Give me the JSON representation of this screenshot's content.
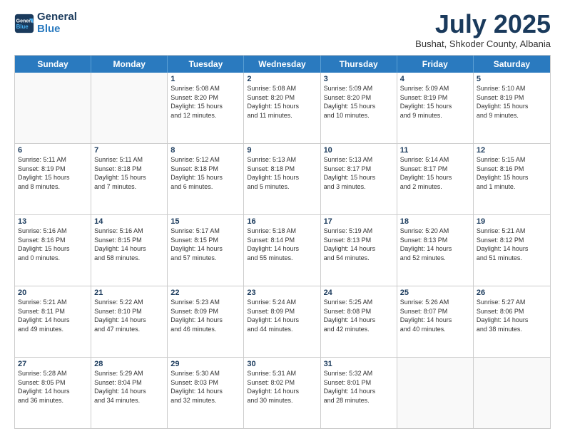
{
  "logo": {
    "general": "General",
    "blue": "Blue"
  },
  "header": {
    "month": "July 2025",
    "location": "Bushat, Shkoder County, Albania"
  },
  "weekdays": [
    "Sunday",
    "Monday",
    "Tuesday",
    "Wednesday",
    "Thursday",
    "Friday",
    "Saturday"
  ],
  "rows": [
    [
      {
        "day": "",
        "info": ""
      },
      {
        "day": "",
        "info": ""
      },
      {
        "day": "1",
        "info": "Sunrise: 5:08 AM\nSunset: 8:20 PM\nDaylight: 15 hours\nand 12 minutes."
      },
      {
        "day": "2",
        "info": "Sunrise: 5:08 AM\nSunset: 8:20 PM\nDaylight: 15 hours\nand 11 minutes."
      },
      {
        "day": "3",
        "info": "Sunrise: 5:09 AM\nSunset: 8:20 PM\nDaylight: 15 hours\nand 10 minutes."
      },
      {
        "day": "4",
        "info": "Sunrise: 5:09 AM\nSunset: 8:19 PM\nDaylight: 15 hours\nand 9 minutes."
      },
      {
        "day": "5",
        "info": "Sunrise: 5:10 AM\nSunset: 8:19 PM\nDaylight: 15 hours\nand 9 minutes."
      }
    ],
    [
      {
        "day": "6",
        "info": "Sunrise: 5:11 AM\nSunset: 8:19 PM\nDaylight: 15 hours\nand 8 minutes."
      },
      {
        "day": "7",
        "info": "Sunrise: 5:11 AM\nSunset: 8:18 PM\nDaylight: 15 hours\nand 7 minutes."
      },
      {
        "day": "8",
        "info": "Sunrise: 5:12 AM\nSunset: 8:18 PM\nDaylight: 15 hours\nand 6 minutes."
      },
      {
        "day": "9",
        "info": "Sunrise: 5:13 AM\nSunset: 8:18 PM\nDaylight: 15 hours\nand 5 minutes."
      },
      {
        "day": "10",
        "info": "Sunrise: 5:13 AM\nSunset: 8:17 PM\nDaylight: 15 hours\nand 3 minutes."
      },
      {
        "day": "11",
        "info": "Sunrise: 5:14 AM\nSunset: 8:17 PM\nDaylight: 15 hours\nand 2 minutes."
      },
      {
        "day": "12",
        "info": "Sunrise: 5:15 AM\nSunset: 8:16 PM\nDaylight: 15 hours\nand 1 minute."
      }
    ],
    [
      {
        "day": "13",
        "info": "Sunrise: 5:16 AM\nSunset: 8:16 PM\nDaylight: 15 hours\nand 0 minutes."
      },
      {
        "day": "14",
        "info": "Sunrise: 5:16 AM\nSunset: 8:15 PM\nDaylight: 14 hours\nand 58 minutes."
      },
      {
        "day": "15",
        "info": "Sunrise: 5:17 AM\nSunset: 8:15 PM\nDaylight: 14 hours\nand 57 minutes."
      },
      {
        "day": "16",
        "info": "Sunrise: 5:18 AM\nSunset: 8:14 PM\nDaylight: 14 hours\nand 55 minutes."
      },
      {
        "day": "17",
        "info": "Sunrise: 5:19 AM\nSunset: 8:13 PM\nDaylight: 14 hours\nand 54 minutes."
      },
      {
        "day": "18",
        "info": "Sunrise: 5:20 AM\nSunset: 8:13 PM\nDaylight: 14 hours\nand 52 minutes."
      },
      {
        "day": "19",
        "info": "Sunrise: 5:21 AM\nSunset: 8:12 PM\nDaylight: 14 hours\nand 51 minutes."
      }
    ],
    [
      {
        "day": "20",
        "info": "Sunrise: 5:21 AM\nSunset: 8:11 PM\nDaylight: 14 hours\nand 49 minutes."
      },
      {
        "day": "21",
        "info": "Sunrise: 5:22 AM\nSunset: 8:10 PM\nDaylight: 14 hours\nand 47 minutes."
      },
      {
        "day": "22",
        "info": "Sunrise: 5:23 AM\nSunset: 8:09 PM\nDaylight: 14 hours\nand 46 minutes."
      },
      {
        "day": "23",
        "info": "Sunrise: 5:24 AM\nSunset: 8:09 PM\nDaylight: 14 hours\nand 44 minutes."
      },
      {
        "day": "24",
        "info": "Sunrise: 5:25 AM\nSunset: 8:08 PM\nDaylight: 14 hours\nand 42 minutes."
      },
      {
        "day": "25",
        "info": "Sunrise: 5:26 AM\nSunset: 8:07 PM\nDaylight: 14 hours\nand 40 minutes."
      },
      {
        "day": "26",
        "info": "Sunrise: 5:27 AM\nSunset: 8:06 PM\nDaylight: 14 hours\nand 38 minutes."
      }
    ],
    [
      {
        "day": "27",
        "info": "Sunrise: 5:28 AM\nSunset: 8:05 PM\nDaylight: 14 hours\nand 36 minutes."
      },
      {
        "day": "28",
        "info": "Sunrise: 5:29 AM\nSunset: 8:04 PM\nDaylight: 14 hours\nand 34 minutes."
      },
      {
        "day": "29",
        "info": "Sunrise: 5:30 AM\nSunset: 8:03 PM\nDaylight: 14 hours\nand 32 minutes."
      },
      {
        "day": "30",
        "info": "Sunrise: 5:31 AM\nSunset: 8:02 PM\nDaylight: 14 hours\nand 30 minutes."
      },
      {
        "day": "31",
        "info": "Sunrise: 5:32 AM\nSunset: 8:01 PM\nDaylight: 14 hours\nand 28 minutes."
      },
      {
        "day": "",
        "info": ""
      },
      {
        "day": "",
        "info": ""
      }
    ]
  ]
}
